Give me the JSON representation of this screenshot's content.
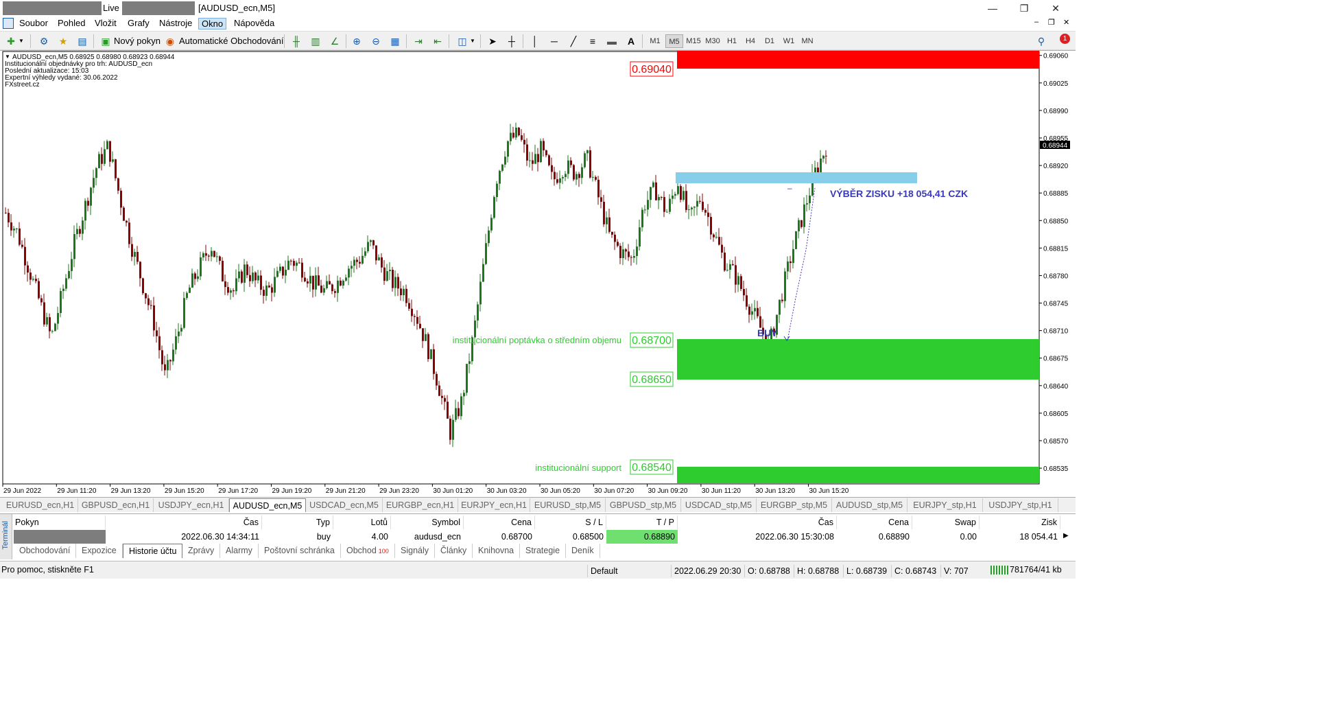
{
  "window": {
    "title_live": "Live -",
    "title_symbol": "[AUDUSD_ecn,M5]",
    "minimize": "—",
    "restore": "❐",
    "close": "✕"
  },
  "menu": [
    "Soubor",
    "Pohled",
    "Vložit",
    "Grafy",
    "Nástroje",
    "Okno",
    "Nápověda"
  ],
  "toolbar": {
    "new_order": "Nový pokyn",
    "auto_trading": "Automatické Obchodování",
    "timeframes": [
      "M1",
      "M5",
      "M15",
      "M30",
      "H1",
      "H4",
      "D1",
      "W1",
      "MN"
    ],
    "selected_timeframe": "M5",
    "notification_count": "1",
    "text_tool": "A"
  },
  "chart_info": {
    "line1": "AUDUSD_ecn,M5  0.68925 0.68980 0.68923 0.68944",
    "line2": "Institucionální objednávky pro trh: AUDUSD_ecn",
    "line3": "Poslední aktualizace: 15:03",
    "line4": "Expertní výhledy vydané: 30.06.2022",
    "line5": "FXstreet.cz"
  },
  "price_axis": [
    "0.69060",
    "0.69025",
    "0.68990",
    "0.68955",
    "0.68920",
    "0.68885",
    "0.68850",
    "0.68815",
    "0.68780",
    "0.68745",
    "0.68710",
    "0.68675",
    "0.68640",
    "0.68605",
    "0.68570",
    "0.68535"
  ],
  "current_price": "0.68944",
  "time_axis": [
    "29 Jun 2022",
    "29 Jun 11:20",
    "29 Jun 13:20",
    "29 Jun 15:20",
    "29 Jun 17:20",
    "29 Jun 19:20",
    "29 Jun 21:20",
    "29 Jun 23:20",
    "30 Jun 01:20",
    "30 Jun 03:20",
    "30 Jun 05:20",
    "30 Jun 07:20",
    "30 Jun 09:20",
    "30 Jun 11:20",
    "30 Jun 13:20",
    "30 Jun 15:20"
  ],
  "levels": {
    "resistance": "0.69040",
    "demand_top": "0.68700",
    "demand_bottom": "0.68650",
    "support": "0.68540",
    "demand_label": "institucionální poptávka o středním objemu",
    "support_label": "institucionální support",
    "profit_label": "VÝBĚR ZISKU +18 054,41 CZK",
    "buy_label": "BUY",
    "tp_dash": "–"
  },
  "colors": {
    "red_zone": "#ff0000",
    "green_zone": "#2ecc2e",
    "tp_zone": "#87ceeb",
    "bull": "#1a7a1a",
    "bear": "#8b0000",
    "annot_blue": "#3a3ab8",
    "level_green": "#2ecc2e"
  },
  "symbol_tabs": [
    "EURUSD_ecn,H1",
    "GBPUSD_ecn,H1",
    "USDJPY_ecn,H1",
    "AUDUSD_ecn,M5",
    "USDCAD_ecn,M5",
    "EURGBP_ecn,H1",
    "EURJPY_ecn,H1",
    "EURUSD_stp,M5",
    "GBPUSD_stp,M5",
    "USDCAD_stp,M5",
    "EURGBP_stp,M5",
    "AUDUSD_stp,M5",
    "EURJPY_stp,H1",
    "USDJPY_stp,H1"
  ],
  "selected_symbol_tab": "AUDUSD_ecn,M5",
  "terminal": {
    "side_label": "Terminál",
    "headers": [
      "Pokyn",
      "Čas",
      "Typ",
      "Lotů",
      "Symbol",
      "Cena",
      "S / L",
      "T / P",
      "Čas",
      "Cena",
      "Swap",
      "Zisk"
    ],
    "row": [
      "",
      "2022.06.30 14:34:11",
      "buy",
      "4.00",
      "audusd_ecn",
      "0.68700",
      "0.68500",
      "0.68890",
      "2022.06.30 15:30:08",
      "0.68890",
      "0.00",
      "18 054.41"
    ],
    "tabs": [
      "Obchodování",
      "Expozice",
      "Historie účtu",
      "Zprávy",
      "Alarmy",
      "Poštovní schránka",
      "Obchod",
      "Signály",
      "Články",
      "Knihovna",
      "Strategie",
      "Deník"
    ],
    "selected_tab": "Historie účtu",
    "obchod_badge": "100"
  },
  "status": {
    "help": "Pro pomoc, stiskněte F1",
    "profile": "Default",
    "datetime": "2022.06.29 20:30",
    "open": "O: 0.68788",
    "high": "H: 0.68788",
    "low": "L: 0.68739",
    "close": "C: 0.68743",
    "volume": "V: 707",
    "traffic": "781764/41 kb"
  },
  "chart_data": {
    "type": "candlestick",
    "symbol": "AUDUSD_ecn",
    "timeframe": "M5",
    "ylim": [
      0.68515,
      0.69065
    ],
    "close_path": [
      0.6886,
      0.68835,
      0.6879,
      0.68745,
      0.687,
      0.6876,
      0.6882,
      0.6887,
      0.6892,
      0.68945,
      0.6888,
      0.6882,
      0.6877,
      0.6872,
      0.6865,
      0.687,
      0.6876,
      0.6879,
      0.6882,
      0.6878,
      0.6876,
      0.6879,
      0.6877,
      0.6876,
      0.6878,
      0.688,
      0.6879,
      0.6877,
      0.6876,
      0.6877,
      0.6879,
      0.688,
      0.6882,
      0.6879,
      0.6877,
      0.6876,
      0.6873,
      0.6869,
      0.6864,
      0.6858,
      0.6862,
      0.687,
      0.688,
      0.689,
      0.6895,
      0.6896,
      0.6892,
      0.6894,
      0.689,
      0.6892,
      0.6891,
      0.6893,
      0.6888,
      0.6883,
      0.6881,
      0.688,
      0.6887,
      0.6889,
      0.6886,
      0.689,
      0.6885,
      0.6888,
      0.6884,
      0.688,
      0.6878,
      0.6875,
      0.6872,
      0.6869,
      0.6875,
      0.6881,
      0.6886,
      0.6891,
      0.68944
    ]
  }
}
